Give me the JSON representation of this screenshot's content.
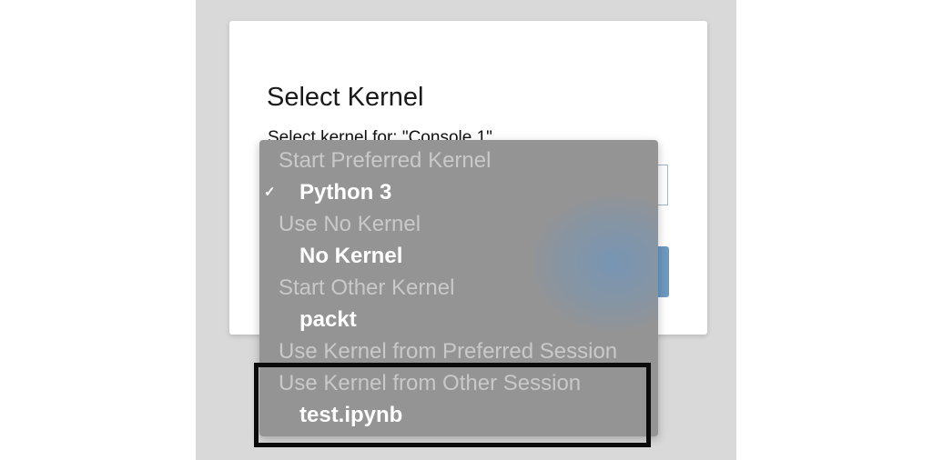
{
  "dialog": {
    "title": "Select Kernel",
    "subtitle": "Select kernel for: \"Console 1\""
  },
  "dropdown": {
    "rows": [
      {
        "kind": "header",
        "label": "Start Preferred Kernel"
      },
      {
        "kind": "item",
        "label": "Python 3",
        "checked": true
      },
      {
        "kind": "header",
        "label": "Use No Kernel"
      },
      {
        "kind": "item",
        "label": "No Kernel"
      },
      {
        "kind": "header",
        "label": "Start Other Kernel"
      },
      {
        "kind": "item",
        "label": "packt"
      },
      {
        "kind": "header",
        "label": "Use Kernel from Preferred Session"
      },
      {
        "kind": "header",
        "label": "Use Kernel from Other Session"
      },
      {
        "kind": "item",
        "label": "test.ipynb"
      }
    ],
    "check_glyph": "✓"
  },
  "colors": {
    "backdrop": "#d9d9d9",
    "menu_background": "#949494",
    "menu_header_text": "#c9c9c9",
    "menu_item_text": "#ffffff",
    "accent": "#6d9ac0",
    "highlight_border": "#0b0b0b"
  }
}
